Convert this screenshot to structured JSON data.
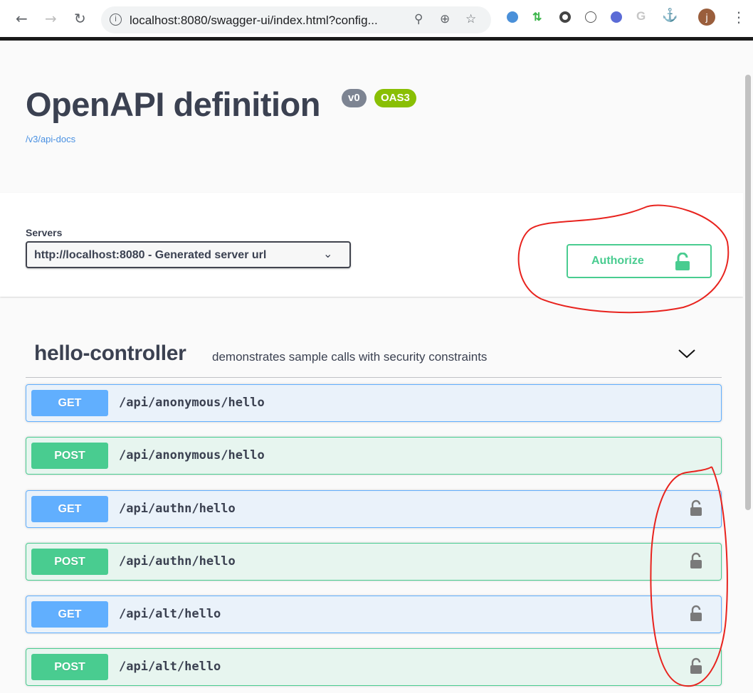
{
  "browser": {
    "back_icon": "arrow-left-icon",
    "forward_icon": "arrow-right-icon",
    "reload_icon": "reload-icon",
    "url": "localhost:8080/swagger-ui/index.html?config...",
    "extensions": [
      "blue-swirl",
      "green-arrows",
      "gray-circle",
      "code-circle",
      "purple-badge",
      "google-g",
      "puzzle",
      "avatar"
    ],
    "avatar_letter": "j"
  },
  "info": {
    "title": "OpenAPI definition",
    "version_badge": "v0",
    "oas_badge": "OAS3",
    "api_docs_link": "/v3/api-docs"
  },
  "scheme": {
    "servers_label": "Servers",
    "server_selected": "http://localhost:8080 - Generated server url",
    "authorize_label": "Authorize"
  },
  "tag": {
    "name": "hello-controller",
    "description": "demonstrates sample calls with security constraints"
  },
  "operations": [
    {
      "method": "GET",
      "path": "/api/anonymous/hello",
      "locked": false
    },
    {
      "method": "POST",
      "path": "/api/anonymous/hello",
      "locked": false
    },
    {
      "method": "GET",
      "path": "/api/authn/hello",
      "locked": true
    },
    {
      "method": "POST",
      "path": "/api/authn/hello",
      "locked": true
    },
    {
      "method": "GET",
      "path": "/api/alt/hello",
      "locked": true
    },
    {
      "method": "POST",
      "path": "/api/alt/hello",
      "locked": true
    }
  ],
  "colors": {
    "get": "#61affe",
    "post": "#49cc90",
    "text": "#3b4151",
    "annotation": "#e8231e"
  }
}
